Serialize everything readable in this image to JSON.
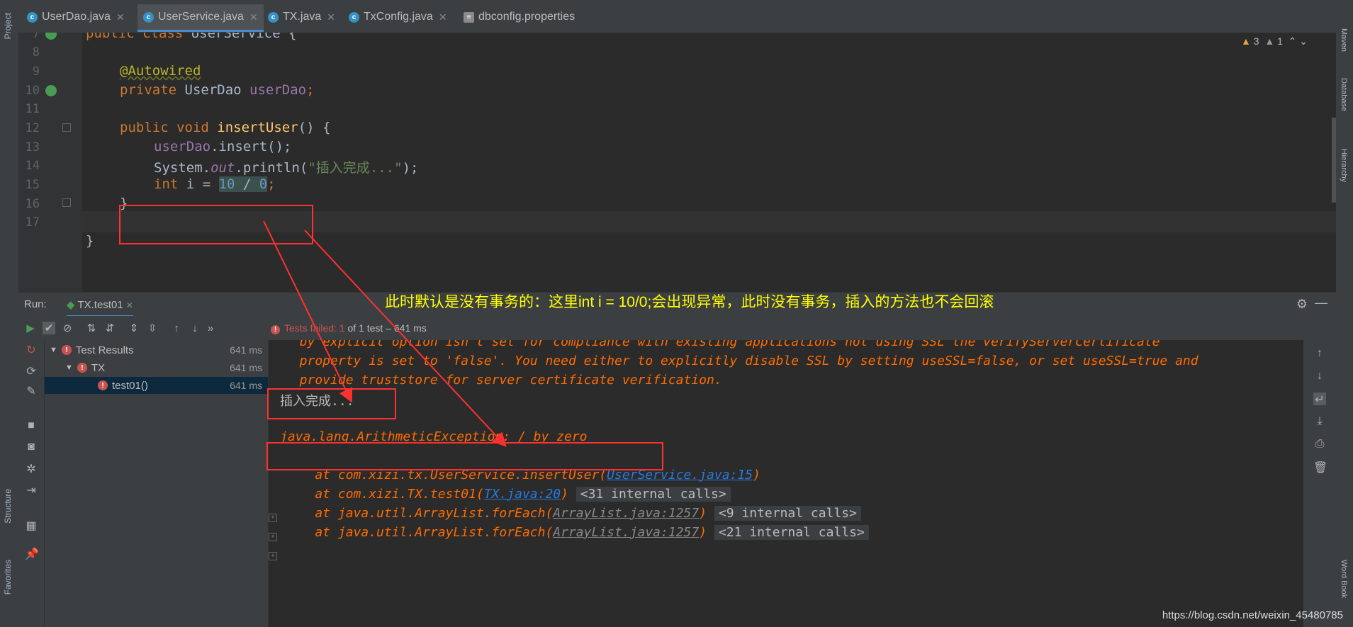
{
  "tabs": [
    {
      "label": "UserDao.java",
      "icon": "class-icon"
    },
    {
      "label": "UserService.java",
      "icon": "class-icon",
      "active": true
    },
    {
      "label": "TX.java",
      "icon": "class-icon"
    },
    {
      "label": "TxConfig.java",
      "icon": "class-icon"
    },
    {
      "label": "dbconfig.properties",
      "icon": "properties-icon"
    }
  ],
  "left_strip": {
    "project": "Project",
    "structure": "Structure",
    "favorites": "Favorites"
  },
  "right_strip": {
    "maven": "Maven",
    "database": "Database",
    "hierarchy": "Hierarchy",
    "wordbook": "Word Book"
  },
  "editor": {
    "line_numbers": [
      "7",
      "8",
      "9",
      "10",
      "11",
      "12",
      "13",
      "14",
      "15",
      "16",
      "17"
    ],
    "warnings": {
      "warn_count": "3",
      "weak_count": "1"
    },
    "code": {
      "l7_kw": "public class ",
      "l7_name": "UserService {",
      "l9_ann": "@Autowired",
      "l10_kw": "private ",
      "l10_type": "UserDao ",
      "l10_field": "userDao",
      "l10_end": ";",
      "l12_kw": "public void ",
      "l12_fn": "insertUser",
      "l12_end": "() {",
      "l13_field": "userDao",
      "l13_end": ".insert();",
      "l14_a": "System.",
      "l14_out": "out",
      "l14_b": ".println(",
      "l14_str": "\"插入完成...\"",
      "l14_c": ");",
      "l15_kw": "int ",
      "l15_a": "i = ",
      "l15_n1": "10",
      "l15_op": " / ",
      "l15_n2": "0",
      "l15_end": ";",
      "l16": "}",
      "l18": "}"
    }
  },
  "annotation": "此时默认是没有事务的：这里int i = 10/0;会出现异常，此时没有事务，插入的方法也不会回滚",
  "run": {
    "label": "Run:",
    "tab": "TX.test01",
    "status_prefix": "Tests failed: ",
    "status_count": "1",
    "status_suffix": " of 1 test – 641 ms"
  },
  "tree": [
    {
      "label": "Test Results",
      "time": "641 ms"
    },
    {
      "label": "TX",
      "time": "641 ms"
    },
    {
      "label": "test01()",
      "time": "641 ms"
    }
  ],
  "console": {
    "line0": "  by explicit option isn't set for compliance with existing applications not using SSL the verifyServerCertificate",
    "line1": "  property is set to 'false'. You need either to explicitly disable SSL by setting useSSL=false, or set useSSL=true and",
    "line2": "  provide truststore for server certificate verification.",
    "printed": "插入完成...",
    "exception": "java.lang.ArithmeticException: / by zero",
    "st1_pre": "    at com.xizi.tx.UserService.insertUser(",
    "st1_link": "UserService.java:15",
    "st1_post": ")",
    "st2_pre": "    at com.xizi.TX.test01(",
    "st2_link": "TX.java:20",
    "st2_post": ")",
    "st2_chip": "<31 internal calls>",
    "st3_pre": "    at java.util.ArrayList.forEach(",
    "st3_link": "ArrayList.java:1257",
    "st3_post": ")",
    "st3_chip": "<9 internal calls>",
    "st4_pre": "    at java.util.ArrayList.forEach(",
    "st4_link": "ArrayList.java:1257",
    "st4_post": ")",
    "st4_chip": "<21 internal calls>"
  },
  "watermark": "https://blog.csdn.net/weixin_45480785",
  "colors": {
    "accent": "#4a88c7",
    "error": "#c75450",
    "annotation": "#ffff00",
    "highlight_box": "#ff3030"
  }
}
